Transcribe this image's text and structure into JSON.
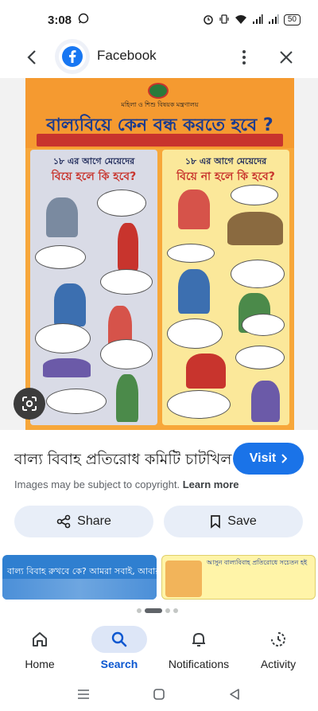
{
  "status_bar": {
    "time": "3:08",
    "battery": "50"
  },
  "header": {
    "site_name": "Facebook"
  },
  "image": {
    "poster_ministry": "মহিলা ও শিশু বিষয়ক মন্ত্রণালয়",
    "poster_title": "বাল্যবিয়ে কেন বন্ধ করতে হবে ?",
    "left_panel_line1": "১৮ এর আগে মেয়েদের",
    "left_panel_line2": "বিয়ে হলে কি হবে?",
    "right_panel_line1": "১৮ এর আগে মেয়েদের",
    "right_panel_line2": "বিয়ে না হলে কি হবে?"
  },
  "result": {
    "title": "বাল্য বিবাহ প্রতিরোধ কমিটি চাটখিল",
    "visit_label": "Visit",
    "copyright_text": "Images may be subject to copyright.",
    "learn_more": "Learn more"
  },
  "actions": {
    "share_label": "Share",
    "save_label": "Save"
  },
  "related": [
    {
      "text": "বাল্য বিবাহ রুখবে কে? আমরা সবাই, আবার কে!"
    },
    {
      "text": "আসুন বাল্যবিবাহ প্রতিরোধে সচেতন হই"
    }
  ],
  "bottom_nav": [
    {
      "label": "Home",
      "icon": "home-icon"
    },
    {
      "label": "Search",
      "icon": "search-icon"
    },
    {
      "label": "Notifications",
      "icon": "bell-icon"
    },
    {
      "label": "Activity",
      "icon": "activity-icon"
    }
  ],
  "colors": {
    "accent": "#1a73e8",
    "nav_active": "#0b57d0",
    "chip_bg": "#e8eef8"
  }
}
